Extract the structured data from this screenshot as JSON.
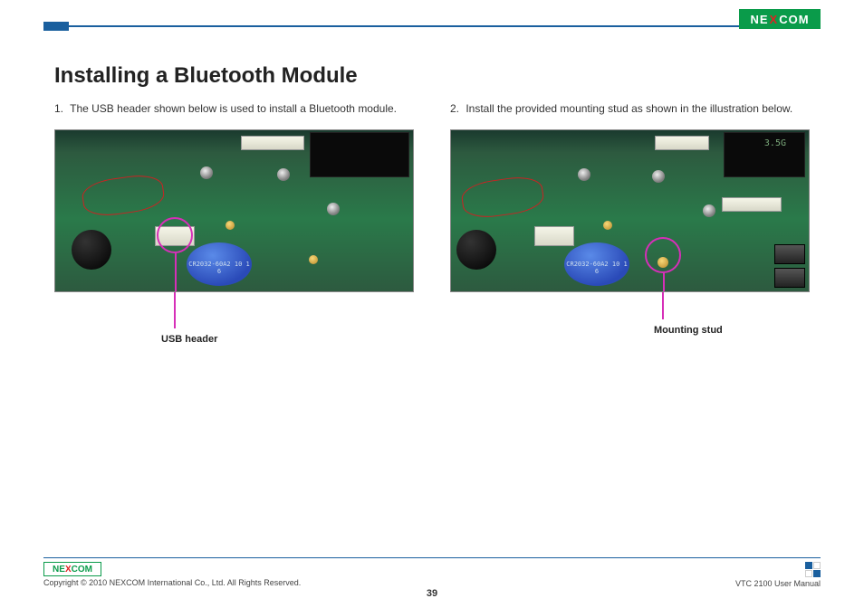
{
  "brand": {
    "name": "NE",
    "x": "X",
    "rest": "COM"
  },
  "heading": "Installing a Bluetooth Module",
  "steps": {
    "s1": {
      "num": "1.",
      "text": "The USB header shown below is used to install a Bluetooth module."
    },
    "s2": {
      "num": "2.",
      "text": "Install the provided mounting stud as shown in the illustration below."
    }
  },
  "captions": {
    "c1": "USB header",
    "c2": "Mounting stud"
  },
  "board": {
    "battery_text": "CR2032-60A2\n10 1 6",
    "marker3g": "3.5G"
  },
  "footer": {
    "copyright": "Copyright © 2010 NEXCOM International Co., Ltd. All Rights Reserved.",
    "manual": "VTC 2100 User Manual",
    "page": "39"
  }
}
